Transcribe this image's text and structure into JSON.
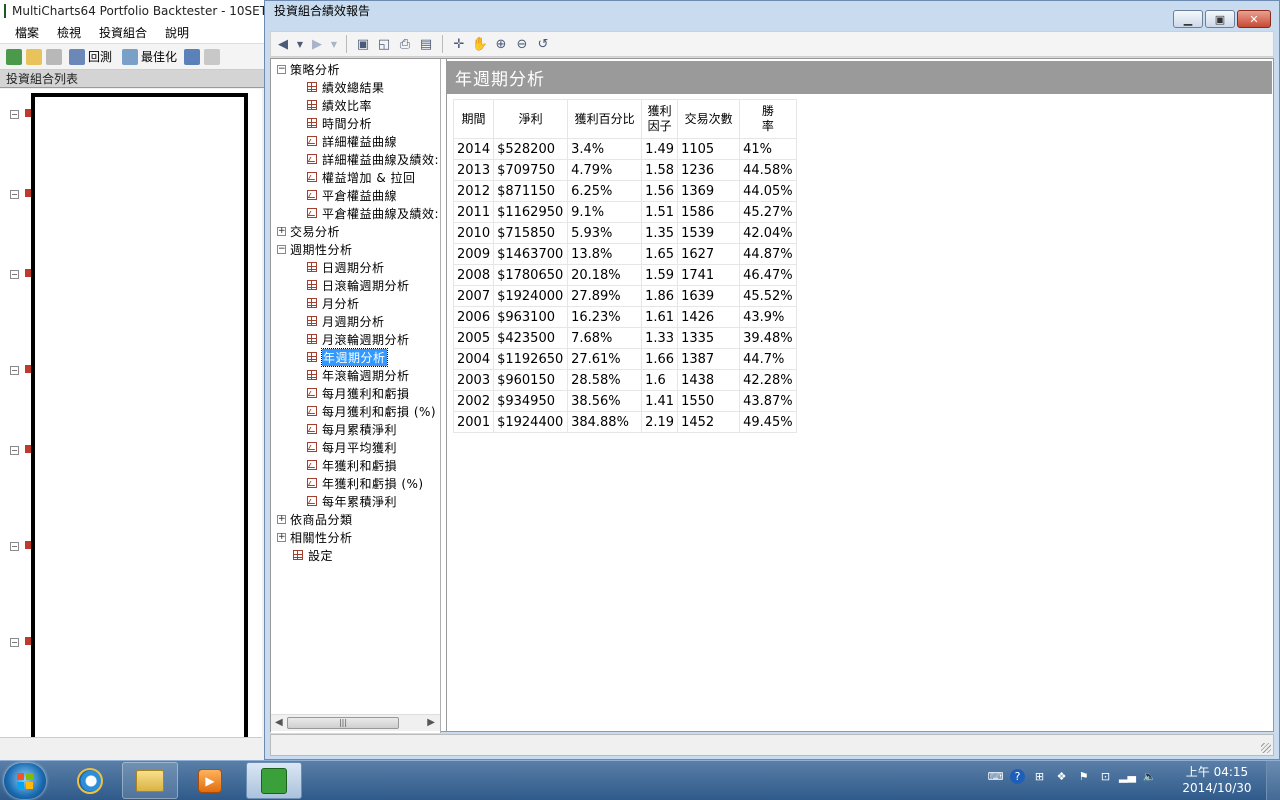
{
  "main_app": {
    "title": "MultiCharts64 Portfolio Backtester - 10SET",
    "menu": [
      "檔案",
      "檢視",
      "投資組合",
      "說明"
    ],
    "toolbar": {
      "backtest_label": "回測",
      "optimize_label": "最佳化"
    },
    "portfolio_list_title": "投資組合列表"
  },
  "report": {
    "window_title": "投資組合績效報告",
    "section_title": "年週期分析",
    "tree": [
      {
        "label": "策略分析",
        "level": 0,
        "expander": "−",
        "icon": "none"
      },
      {
        "label": "績效總結果",
        "level": 1,
        "icon": "grid"
      },
      {
        "label": "績效比率",
        "level": 1,
        "icon": "grid"
      },
      {
        "label": "時間分析",
        "level": 1,
        "icon": "grid"
      },
      {
        "label": "詳細權益曲線",
        "level": 1,
        "icon": "chart"
      },
      {
        "label": "詳細權益曲線及績效:",
        "level": 1,
        "icon": "chart"
      },
      {
        "label": "權益增加 & 拉回",
        "level": 1,
        "icon": "chart"
      },
      {
        "label": "平倉權益曲線",
        "level": 1,
        "icon": "chart"
      },
      {
        "label": "平倉權益曲線及績效:",
        "level": 1,
        "icon": "chart"
      },
      {
        "label": "交易分析",
        "level": 0,
        "expander": "+",
        "icon": "none"
      },
      {
        "label": "週期性分析",
        "level": 0,
        "expander": "−",
        "icon": "none"
      },
      {
        "label": "日週期分析",
        "level": 1,
        "icon": "grid"
      },
      {
        "label": "日滾輪週期分析",
        "level": 1,
        "icon": "grid"
      },
      {
        "label": "月分析",
        "level": 1,
        "icon": "grid"
      },
      {
        "label": "月週期分析",
        "level": 1,
        "icon": "grid"
      },
      {
        "label": "月滾輪週期分析",
        "level": 1,
        "icon": "grid"
      },
      {
        "label": "年週期分析",
        "level": 1,
        "icon": "grid",
        "selected": true
      },
      {
        "label": "年滾輪週期分析",
        "level": 1,
        "icon": "grid"
      },
      {
        "label": "每月獲利和虧損",
        "level": 1,
        "icon": "chart"
      },
      {
        "label": "每月獲利和虧損 (%)",
        "level": 1,
        "icon": "chart"
      },
      {
        "label": "每月累積淨利",
        "level": 1,
        "icon": "chart"
      },
      {
        "label": "每月平均獲利",
        "level": 1,
        "icon": "chart"
      },
      {
        "label": "年獲利和虧損",
        "level": 1,
        "icon": "chart"
      },
      {
        "label": "年獲利和虧損 (%)",
        "level": 1,
        "icon": "chart"
      },
      {
        "label": "每年累積淨利",
        "level": 1,
        "icon": "chart"
      },
      {
        "label": "依商品分類",
        "level": 0,
        "expander": "+",
        "icon": "none"
      },
      {
        "label": "相關性分析",
        "level": 0,
        "expander": "+",
        "icon": "none"
      },
      {
        "label": "設定",
        "level": 0,
        "expander": "",
        "icon": "grid"
      }
    ],
    "table": {
      "headers": [
        "期間",
        "淨利",
        "獲利百分比",
        "獲利\n因子",
        "交易次數",
        "勝\n率"
      ],
      "rows": [
        [
          "2014",
          "$528200",
          "3.4%",
          "1.49",
          "1105",
          "41%"
        ],
        [
          "2013",
          "$709750",
          "4.79%",
          "1.58",
          "1236",
          "44.58%"
        ],
        [
          "2012",
          "$871150",
          "6.25%",
          "1.56",
          "1369",
          "44.05%"
        ],
        [
          "2011",
          "$1162950",
          "9.1%",
          "1.51",
          "1586",
          "45.27%"
        ],
        [
          "2010",
          "$715850",
          "5.93%",
          "1.35",
          "1539",
          "42.04%"
        ],
        [
          "2009",
          "$1463700",
          "13.8%",
          "1.65",
          "1627",
          "44.87%"
        ],
        [
          "2008",
          "$1780650",
          "20.18%",
          "1.59",
          "1741",
          "46.47%"
        ],
        [
          "2007",
          "$1924000",
          "27.89%",
          "1.86",
          "1639",
          "45.52%"
        ],
        [
          "2006",
          "$963100",
          "16.23%",
          "1.61",
          "1426",
          "43.9%"
        ],
        [
          "2005",
          "$423500",
          "7.68%",
          "1.33",
          "1335",
          "39.48%"
        ],
        [
          "2004",
          "$1192650",
          "27.61%",
          "1.66",
          "1387",
          "44.7%"
        ],
        [
          "2003",
          "$960150",
          "28.58%",
          "1.6",
          "1438",
          "42.28%"
        ],
        [
          "2002",
          "$934950",
          "38.56%",
          "1.41",
          "1550",
          "43.87%"
        ],
        [
          "2001",
          "$1924400",
          "384.88%",
          "2.19",
          "1452",
          "49.45%"
        ]
      ]
    }
  },
  "taskbar": {
    "clock_time": "上午 04:15",
    "clock_date": "2014/10/30"
  }
}
